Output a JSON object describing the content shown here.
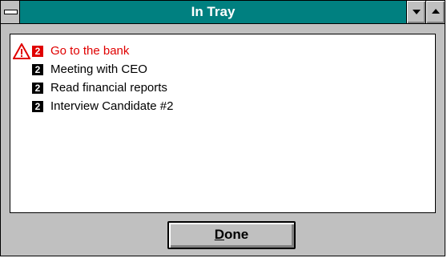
{
  "window": {
    "title": "In Tray",
    "title_bar_color": "#008080"
  },
  "list": {
    "items": [
      {
        "label": "Go to the bank",
        "priority": "2",
        "color": "#e00000",
        "warning_icon": "warning-triangle-icon"
      },
      {
        "label": "Meeting with CEO",
        "priority": "2",
        "color": "#000000"
      },
      {
        "label": "Read financial reports",
        "priority": "2",
        "color": "#000000"
      },
      {
        "label": "Interview Candidate #2",
        "priority": "2",
        "color": "#000000"
      }
    ]
  },
  "footer": {
    "done_button": {
      "label_mnemonic": "D",
      "label_rest": "one"
    }
  }
}
